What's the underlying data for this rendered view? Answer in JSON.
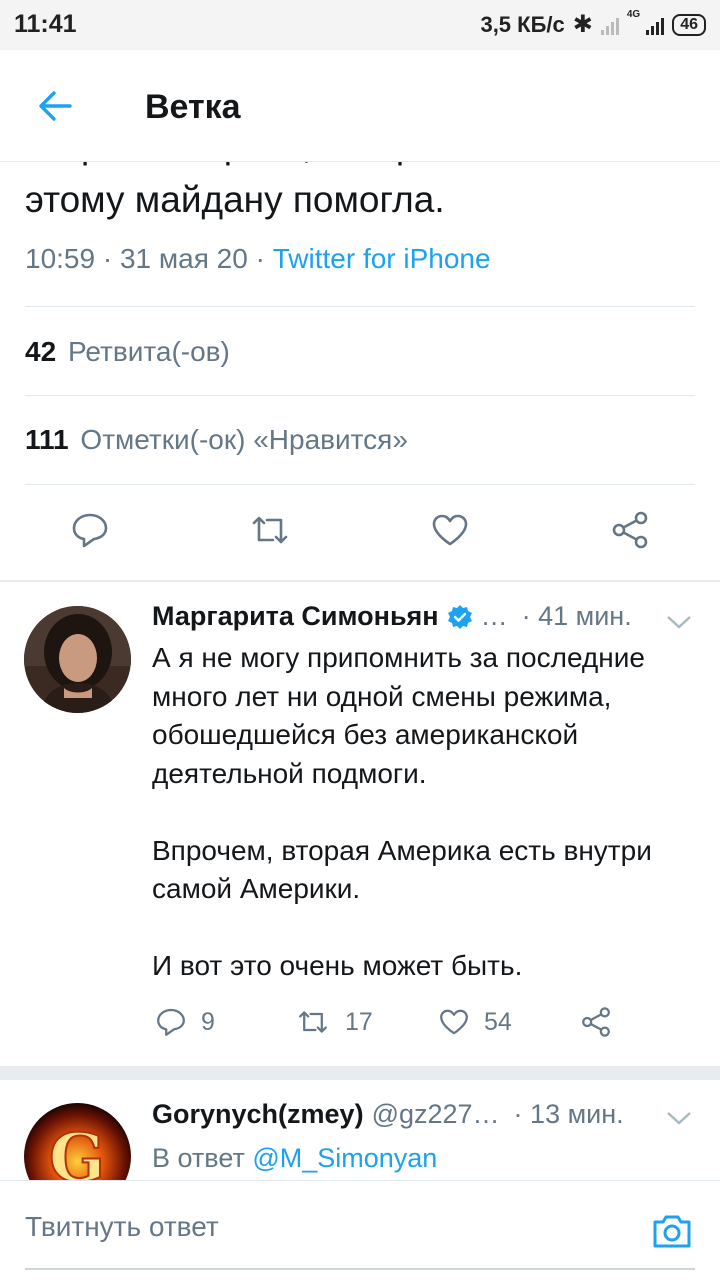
{
  "status_bar": {
    "time": "11:41",
    "speed": "3,5 КБ/с",
    "network": "4G",
    "battery": "46"
  },
  "header": {
    "title": "Ветка"
  },
  "main_tweet": {
    "text_partial_top": "второй Америки, которая бы",
    "text_last_line": "этому майдану помогла.",
    "time": "10:59",
    "date": "31 мая 20",
    "source": "Twitter for iPhone",
    "retweets_count": "42",
    "retweets_label": "Ретвита(-ов)",
    "likes_count": "111",
    "likes_label": "Отметки(-ок) «Нравится»"
  },
  "replies": [
    {
      "name": "Маргарита Симоньян",
      "handle": "…",
      "time": "41 мин.",
      "paragraphs": [
        "А я не могу припомнить за последние много лет ни одной смены режима, обошедшейся без американской деятельной подмоги.",
        "Впрочем, вторая Америка есть внутри самой Америки.",
        "И вот это очень может быть."
      ],
      "reply_count": "9",
      "retweet_count": "17",
      "like_count": "54"
    },
    {
      "name": "Gorynych(zmey)",
      "handle": "@gz227…",
      "time": "13 мин.",
      "reply_prefix": "В ответ",
      "reply_target": "@M_Simonyan"
    }
  ],
  "compose": {
    "placeholder": "Твитнуть ответ"
  },
  "colors": {
    "accent": "#1da1f2",
    "secondary_text": "#657786",
    "divider": "#e1e8ed"
  }
}
